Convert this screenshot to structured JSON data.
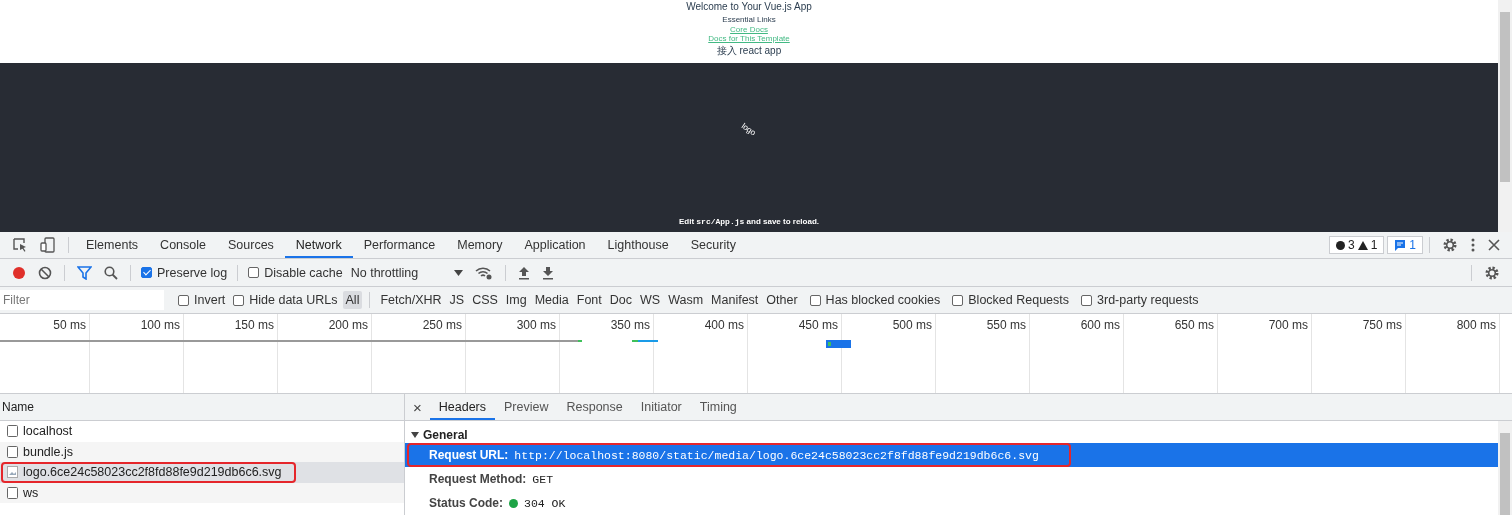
{
  "page": {
    "title": "Welcome to Your Vue.js App",
    "subtitle": "Essential Links",
    "links": [
      "Core Docs",
      "Docs for This Template"
    ],
    "react_line": "接入 react app",
    "app": {
      "image_alt": "logo",
      "message": [
        {
          "kind": "text",
          "text": "Edit "
        },
        {
          "kind": "code",
          "text": "src/App.js"
        },
        {
          "kind": "text",
          "text": " and save to reload."
        }
      ]
    }
  },
  "devtools": {
    "tabs": [
      {
        "label": "Elements",
        "selected": false
      },
      {
        "label": "Console",
        "selected": false
      },
      {
        "label": "Sources",
        "selected": false
      },
      {
        "label": "Network",
        "selected": true
      },
      {
        "label": "Performance",
        "selected": false
      },
      {
        "label": "Memory",
        "selected": false
      },
      {
        "label": "Application",
        "selected": false
      },
      {
        "label": "Lighthouse",
        "selected": false
      },
      {
        "label": "Security",
        "selected": false
      }
    ],
    "counts": {
      "errors": "3",
      "warnings": "1",
      "messages": "1"
    },
    "toolbar": {
      "recording": true,
      "preserve_log": {
        "label": "Preserve log",
        "checked": true
      },
      "disable_cache": {
        "label": "Disable cache",
        "checked": false
      },
      "throttling": "No throttling"
    },
    "filter": {
      "placeholder": "Filter",
      "checks": [
        {
          "label": "Invert",
          "checked": false
        },
        {
          "label": "Hide data URLs",
          "checked": false
        }
      ],
      "types": [
        {
          "label": "All",
          "selected": true
        },
        {
          "label": "Fetch/XHR",
          "selected": false
        },
        {
          "label": "JS",
          "selected": false
        },
        {
          "label": "CSS",
          "selected": false
        },
        {
          "label": "Img",
          "selected": false
        },
        {
          "label": "Media",
          "selected": false
        },
        {
          "label": "Font",
          "selected": false
        },
        {
          "label": "Doc",
          "selected": false
        },
        {
          "label": "WS",
          "selected": false
        },
        {
          "label": "Wasm",
          "selected": false
        },
        {
          "label": "Manifest",
          "selected": false
        },
        {
          "label": "Other",
          "selected": false
        }
      ],
      "more_checks": [
        {
          "label": "Has blocked cookies",
          "checked": false
        },
        {
          "label": "Blocked Requests",
          "checked": false
        },
        {
          "label": "3rd-party requests",
          "checked": false
        }
      ]
    },
    "timeline": {
      "ticks": [
        "50 ms",
        "100 ms",
        "150 ms",
        "200 ms",
        "250 ms",
        "300 ms",
        "350 ms",
        "400 ms",
        "450 ms",
        "500 ms",
        "550 ms",
        "600 ms",
        "650 ms",
        "700 ms",
        "750 ms",
        "800 ms"
      ]
    },
    "requests": {
      "column": "Name",
      "rows": [
        {
          "name": "localhost",
          "kind": "doc",
          "selected": false,
          "highlighted": false
        },
        {
          "name": "bundle.js",
          "kind": "doc",
          "selected": false,
          "highlighted": false
        },
        {
          "name": "logo.6ce24c58023cc2f8fd88fe9d219db6c6.svg",
          "kind": "image",
          "selected": true,
          "highlighted": true
        },
        {
          "name": "ws",
          "kind": "doc",
          "selected": false,
          "highlighted": false
        }
      ]
    },
    "details": {
      "close": "×",
      "tabs": [
        {
          "label": "Headers",
          "selected": true
        },
        {
          "label": "Preview",
          "selected": false
        },
        {
          "label": "Response",
          "selected": false
        },
        {
          "label": "Initiator",
          "selected": false
        },
        {
          "label": "Timing",
          "selected": false
        }
      ],
      "section": {
        "title": "General",
        "expanded": true
      },
      "rows": [
        {
          "kind": "text",
          "label": "Request URL:",
          "value": "http://localhost:8080/static/media/logo.6ce24c58023cc2f8fd88fe9d219db6c6.svg",
          "selected": true,
          "highlighted": true
        },
        {
          "kind": "text",
          "label": "Request Method:",
          "value": "GET",
          "selected": false,
          "highlighted": false
        },
        {
          "kind": "status",
          "label": "Status Code:",
          "value": "304 OK",
          "color": "#1ea446",
          "selected": false,
          "highlighted": false
        }
      ]
    }
  }
}
